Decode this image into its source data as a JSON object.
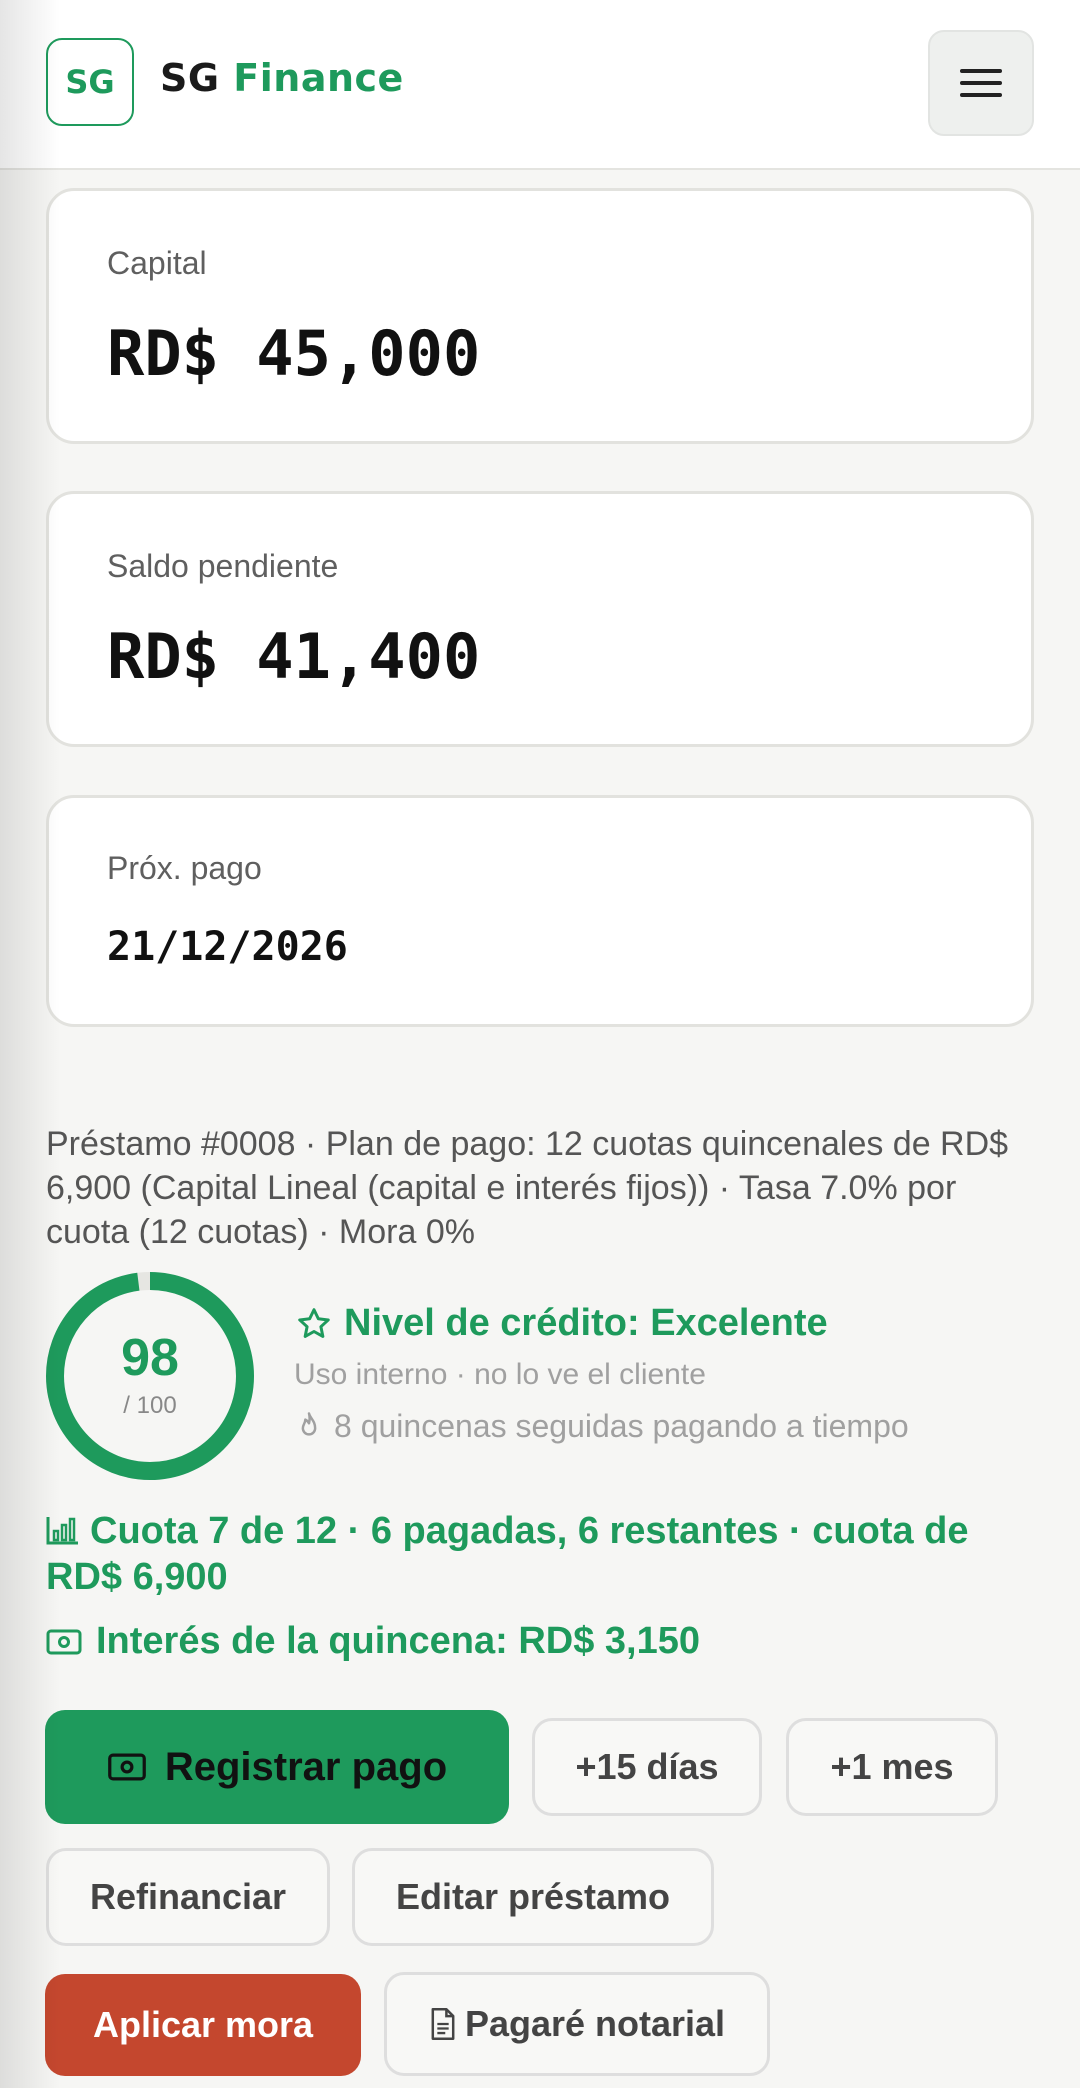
{
  "header": {
    "logo_text": "SG",
    "brand_prefix": "SG",
    "brand_suffix": "Finance",
    "menu_icon": "hamburger-menu-icon"
  },
  "cards": {
    "capital": {
      "label": "Capital",
      "value": "RD$ 45,000"
    },
    "saldo": {
      "label": "Saldo pendiente",
      "value": "RD$ 41,400"
    },
    "proximo_pago": {
      "label": "Próx. pago",
      "value": "21/12/2026"
    }
  },
  "loan": {
    "description": "Préstamo #0008 · Plan de pago: 12 cuotas quincenales de RD$ 6,900 (Capital Lineal (capital e interés fijos)) · Tasa 7.0% por cuota (12 cuotas) · Mora 0%"
  },
  "score": {
    "value": "98",
    "max_label": "/ 100",
    "fraction": 0.98,
    "level_title": "Nivel de crédito: Excelente",
    "level_sub": "Uso interno · no lo ve el cliente",
    "streak": "8 quincenas seguidas pagando a tiempo"
  },
  "cuota": {
    "text": "Cuota 7 de 12 · 6 pagadas, 6 restantes · cuota de RD$ 6,900"
  },
  "interest": {
    "text": "Interés de la quincena: RD$ 3,150"
  },
  "actions": {
    "registrar": "Registrar pago",
    "plus15": "+15 días",
    "plus_mes": "+1 mes",
    "refinanciar": "Refinanciar",
    "editar": "Editar préstamo",
    "aplicar_mora": "Aplicar mora",
    "pagare": "Pagaré notarial"
  },
  "colors": {
    "accent": "#1e9a5c",
    "danger": "#c4472e",
    "muted": "#a0a0a0"
  }
}
